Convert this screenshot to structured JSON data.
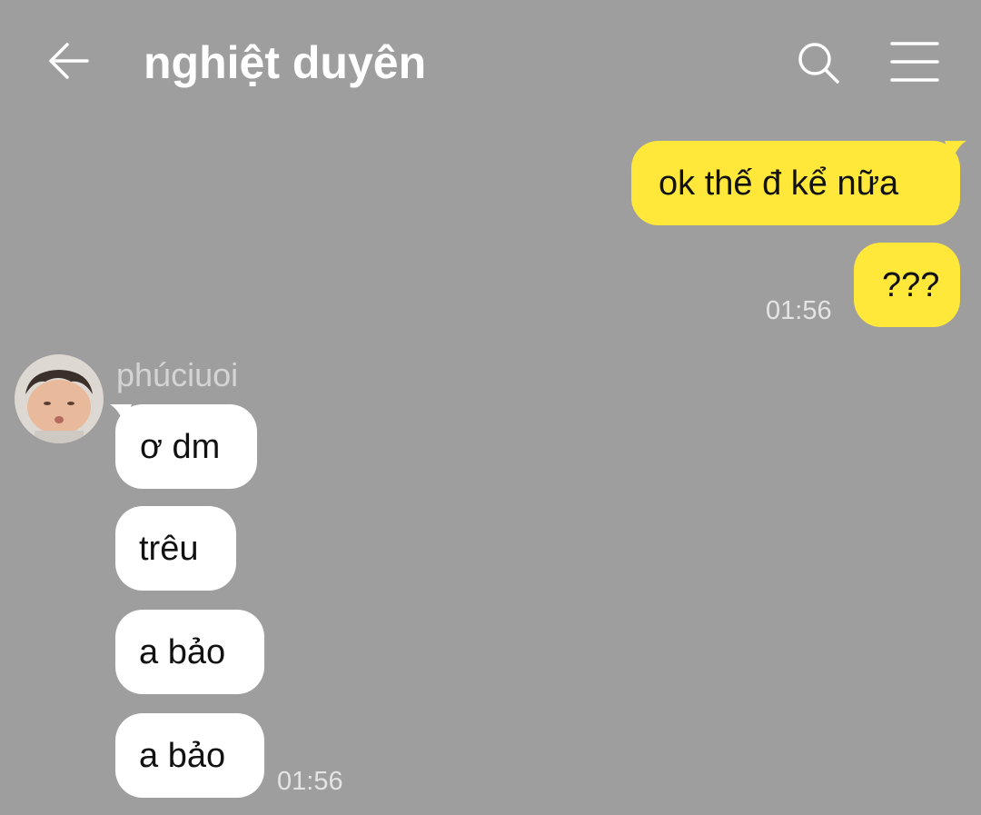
{
  "header": {
    "title": "nghiệt duyên",
    "back_icon": "arrow-left-icon",
    "search_icon": "search-icon",
    "menu_icon": "menu-icon"
  },
  "colors": {
    "background": "#9e9e9e",
    "outgoing_bubble": "#ffe839",
    "incoming_bubble": "#ffffff"
  },
  "messages": {
    "outgoing": [
      {
        "text": "ok thế đ kể nữa"
      },
      {
        "text": "???",
        "time": "01:56"
      }
    ],
    "incoming_sender": "phúciuoi",
    "incoming": [
      {
        "text": "ơ dm"
      },
      {
        "text": "trêu"
      },
      {
        "text": "a bảo"
      },
      {
        "text": "a bảo",
        "time": "01:56"
      }
    ]
  }
}
